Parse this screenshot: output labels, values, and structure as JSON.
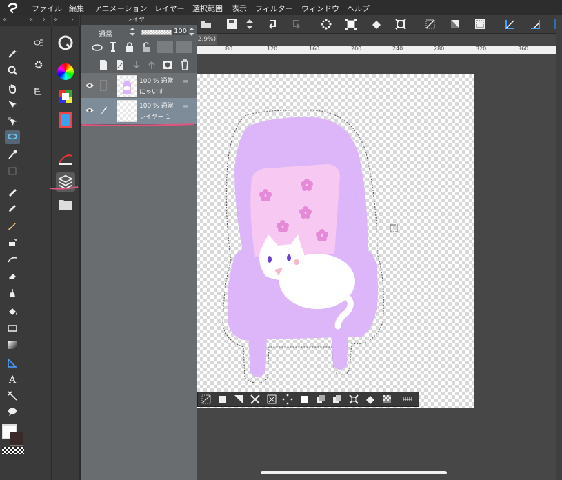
{
  "menubar": {
    "items": [
      "ファイル",
      "編集",
      "アニメーション",
      "レイヤー",
      "選択範囲",
      "表示",
      "フィルター",
      "ウィンドウ",
      "ヘルプ"
    ]
  },
  "canvas_view": {
    "zoom_label": "2.9%)",
    "ruler_ticks": [
      "80",
      "120",
      "160",
      "200",
      "240",
      "280",
      "320",
      "360"
    ]
  },
  "layer_panel": {
    "title": "レイヤー",
    "blend_mode": "通常",
    "opacity": "100",
    "layers": [
      {
        "info": "100 % 通常",
        "name": "にゃいす",
        "selected": false
      },
      {
        "info": "100 % 通常",
        "name": "レイヤー 1",
        "selected": true
      }
    ]
  },
  "colors": {
    "annotation_stroke": "#e0557f",
    "chair": "#dcb6f8",
    "cushion": "#f6c8f2",
    "flower": "#e58ad8",
    "selection_accent": "#7e8c99"
  },
  "icons": {
    "toolbar": [
      "open-folder-icon",
      "save-icon",
      "undo-icon",
      "redo-icon",
      "transform-icon",
      "crop-icon",
      "fill-icon",
      "deselect-icon",
      "invert-icon",
      "select-all-icon",
      "ruler-icon",
      "perspective-icon"
    ],
    "tools": [
      "magic-wand-icon",
      "zoom-icon",
      "hand-icon",
      "move-layer-icon",
      "lasso-select-icon",
      "eyedropper-icon",
      "pen-icon",
      "pencil-icon",
      "brush-icon",
      "airbrush-icon",
      "decoration-icon",
      "eraser-icon",
      "blend-icon",
      "fill-bucket-icon",
      "rectangle-icon",
      "gradient-icon",
      "ruler-tool-icon",
      "text-icon",
      "balloon-tool-icon",
      "speech-balloon-icon"
    ]
  }
}
